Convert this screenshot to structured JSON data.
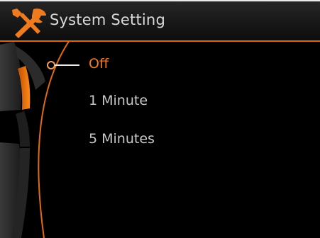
{
  "header": {
    "title": "System Setting",
    "icon": "tools-icon"
  },
  "menu": {
    "items": [
      {
        "label": "Off",
        "selected": true
      },
      {
        "label": "1 Minute",
        "selected": false
      },
      {
        "label": "5 Minutes",
        "selected": false
      }
    ]
  },
  "colors": {
    "accent": "#f07a1e",
    "text": "#c8c8c8",
    "background": "#000000"
  }
}
